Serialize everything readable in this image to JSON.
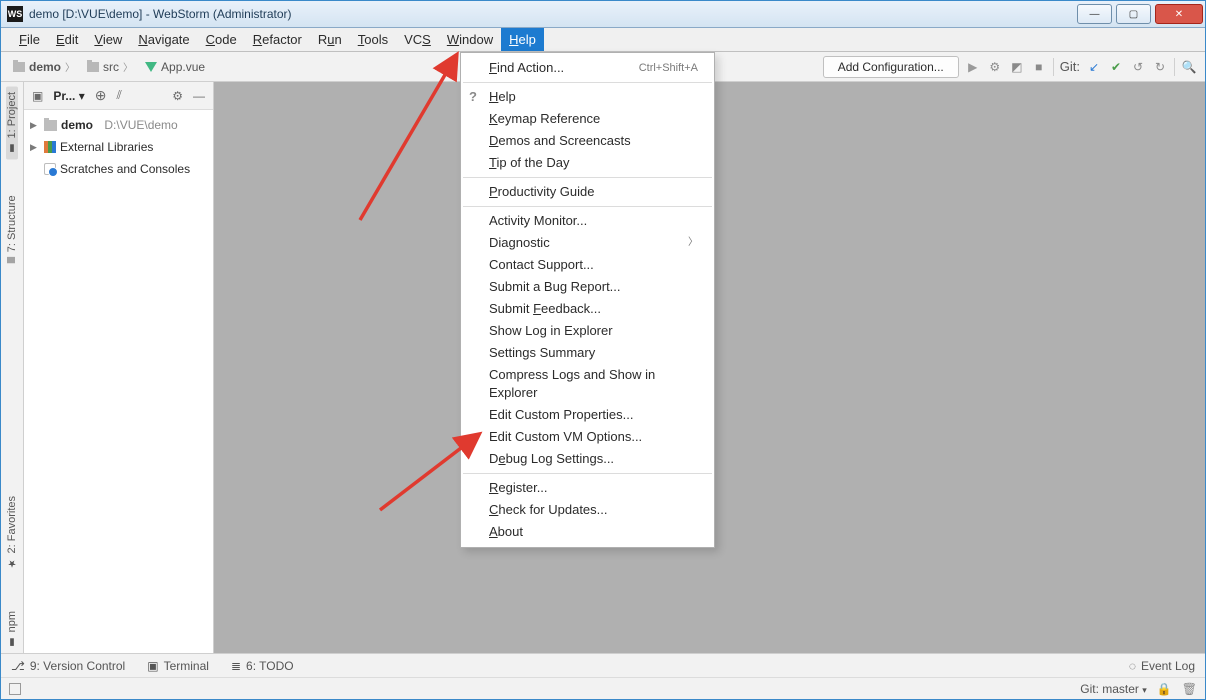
{
  "titlebar": {
    "logo_text": "WS",
    "title": "demo [D:\\VUE\\demo] - WebStorm (Administrator)"
  },
  "menubar": {
    "items": [
      "File",
      "Edit",
      "View",
      "Navigate",
      "Code",
      "Refactor",
      "Run",
      "Tools",
      "VCS",
      "Window",
      "Help"
    ],
    "active_index": 10
  },
  "breadcrumbs": {
    "items": [
      "demo",
      "src",
      "App.vue"
    ]
  },
  "toolbar": {
    "add_config": "Add Configuration...",
    "git_label": "Git:"
  },
  "side_tabs_left": [
    "1: Project",
    "7: Structure",
    "2: Favorites",
    "npm"
  ],
  "project_panel": {
    "header_label": "Pr...",
    "root_name": "demo",
    "root_path": "D:\\VUE\\demo",
    "ext_lib": "External Libraries",
    "scratches": "Scratches and Consoles"
  },
  "help_menu": {
    "find_action": "Find Action...",
    "find_action_hint": "Ctrl+Shift+A",
    "help": "Help",
    "keymap": "Keymap Reference",
    "demos": "Demos and Screencasts",
    "tip": "Tip of the Day",
    "productivity": "Productivity Guide",
    "activity": "Activity Monitor...",
    "diagnostic": "Diagnostic",
    "contact": "Contact Support...",
    "bug": "Submit a Bug Report...",
    "feedback": "Submit Feedback...",
    "showlog": "Show Log in Explorer",
    "settings_summary": "Settings Summary",
    "compress": "Compress Logs and Show in Explorer",
    "edit_props": "Edit Custom Properties...",
    "edit_vm": "Edit Custom VM Options...",
    "debug_log": "Debug Log Settings...",
    "register": "Register...",
    "check_updates": "Check for Updates...",
    "about": "About"
  },
  "bottom_tools": {
    "version_control": "9: Version Control",
    "terminal": "Terminal",
    "todo": "6: TODO",
    "event_log": "Event Log"
  },
  "statusbar": {
    "git_branch": "Git: master"
  }
}
